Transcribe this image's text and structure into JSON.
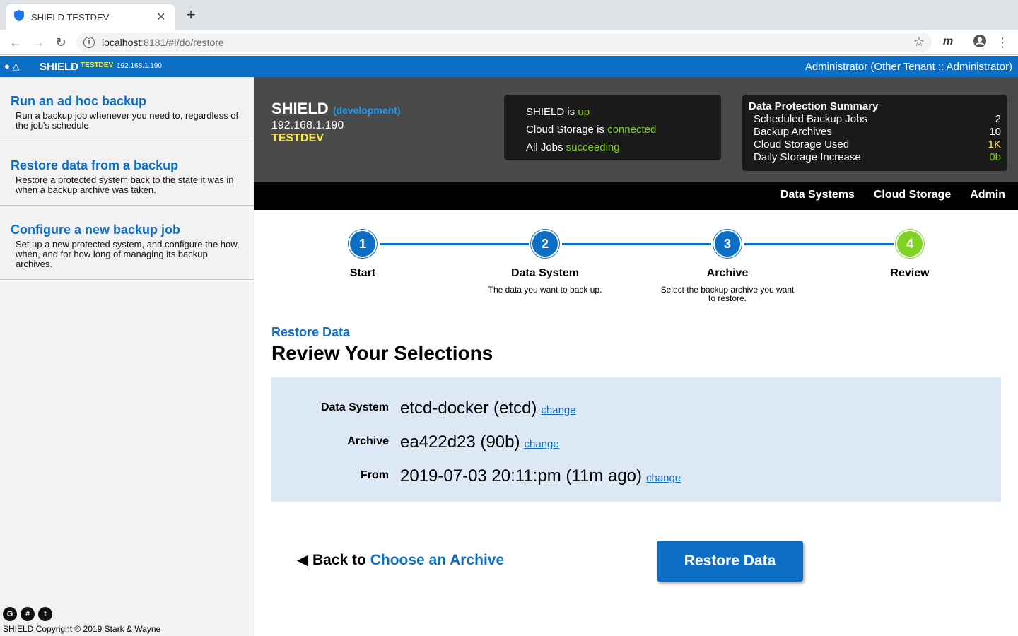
{
  "browser": {
    "tab_title": "SHIELD TESTDEV",
    "url_host": "localhost",
    "url_path": ":8181/#!/do/restore",
    "ext_label": "m"
  },
  "appbar": {
    "brand": "SHIELD",
    "env": "TESTDEV",
    "ip": "192.168.1.190",
    "user": "Administrator (Other Tenant :: Administrator)"
  },
  "sidebar": {
    "items": [
      {
        "title": "Run an ad hoc backup",
        "desc": "Run a backup job whenever you need to, regardless of the job's schedule."
      },
      {
        "title": "Restore data from a backup",
        "desc": "Restore a protected system back to the state it was in when a backup archive was taken."
      },
      {
        "title": "Configure a new backup job",
        "desc": "Set up a new protected system, and configure the how, when, and for how long of managing its backup archives."
      }
    ],
    "copyright": "SHIELD Copyright © 2019 Stark & Wayne"
  },
  "dashboard": {
    "name": "SHIELD",
    "dev_label": "(development)",
    "ip": "192.168.1.190",
    "env": "TESTDEV",
    "status": [
      {
        "prefix": "SHIELD is ",
        "value": "up"
      },
      {
        "prefix": "Cloud Storage is ",
        "value": "connected"
      },
      {
        "prefix": "All Jobs ",
        "value": "succeeding"
      }
    ],
    "summary_title": "Data Protection Summary",
    "summary": [
      {
        "label": "Scheduled Backup Jobs",
        "value": "2"
      },
      {
        "label": "Backup Archives",
        "value": "10"
      },
      {
        "label": "Cloud Storage Used",
        "value": "1K"
      },
      {
        "label": "Daily Storage Increase",
        "value": "0b"
      }
    ],
    "colors": {
      "ok": "#7ed321",
      "warn": "#ffeb3b",
      "accent": "#0d6ec6"
    }
  },
  "nav": {
    "links": [
      "Data Systems",
      "Cloud Storage",
      "Admin"
    ]
  },
  "steps": [
    {
      "num": "1",
      "label": "Start",
      "desc": ""
    },
    {
      "num": "2",
      "label": "Data System",
      "desc": "The data you want to back up."
    },
    {
      "num": "3",
      "label": "Archive",
      "desc": "Select the backup archive you want to restore."
    },
    {
      "num": "4",
      "label": "Review",
      "desc": ""
    }
  ],
  "review": {
    "subtitle": "Restore Data",
    "title": "Review Your Selections",
    "rows": [
      {
        "label": "Data System",
        "value": "etcd-docker (etcd)",
        "action": "change"
      },
      {
        "label": "Archive",
        "value": "ea422d23 (90b)",
        "action": "change"
      },
      {
        "label": "From",
        "value": "2019-07-03 20:11:pm (11m ago)",
        "action": "change"
      }
    ],
    "back_prefix": "Back to",
    "back_link": "Choose an Archive",
    "submit": "Restore Data"
  }
}
